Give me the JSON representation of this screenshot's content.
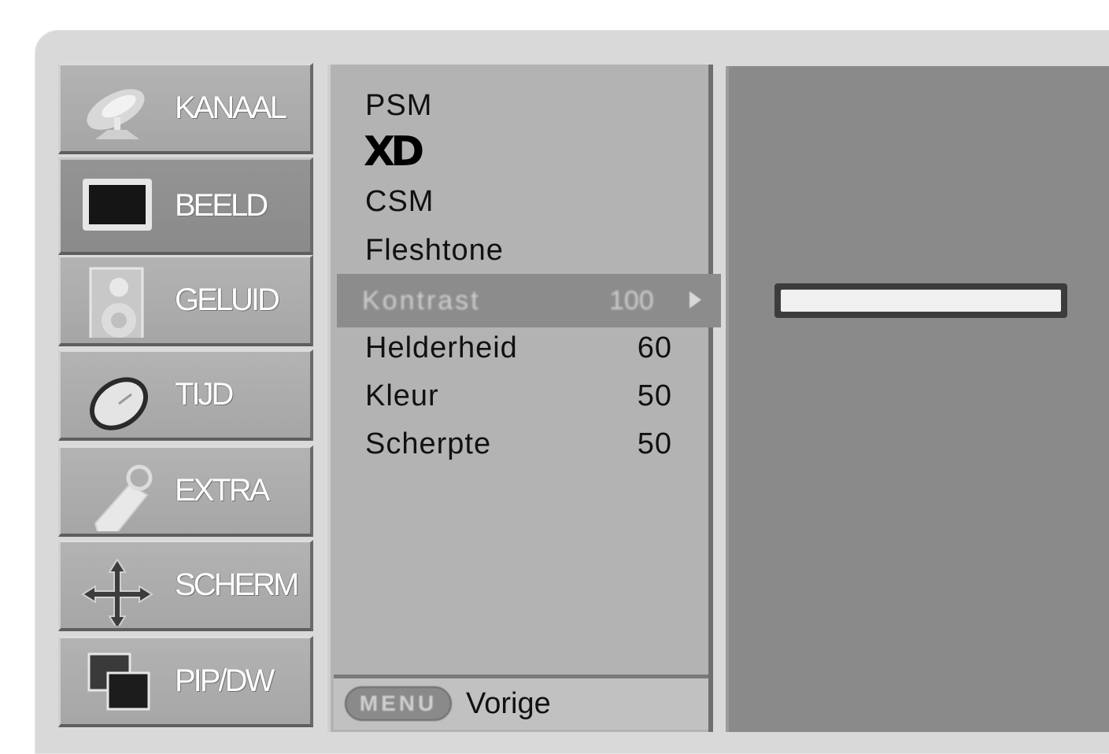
{
  "categories": [
    {
      "label": "KANAAL",
      "icon": "satellite-dish-icon"
    },
    {
      "label": "BEELD",
      "icon": "tv-screen-icon"
    },
    {
      "label": "GELUID",
      "icon": "speaker-icon"
    },
    {
      "label": "TIJD",
      "icon": "clock-icon"
    },
    {
      "label": "EXTRA",
      "icon": "tag-icon"
    },
    {
      "label": "SCHERM",
      "icon": "move-arrows-icon"
    },
    {
      "label": "PIP/DW",
      "icon": "pip-windows-icon"
    }
  ],
  "active_category": "BEELD",
  "submenu": {
    "psm": "PSM",
    "xd": "XD",
    "csm": "CSM",
    "fleshtone": "Fleshtone",
    "selected": {
      "label": "Kontrast",
      "value": "100"
    },
    "items": [
      {
        "label": "Helderheid",
        "value": "60"
      },
      {
        "label": "Kleur",
        "value": "50"
      },
      {
        "label": "Scherpte",
        "value": "50"
      }
    ]
  },
  "footer": {
    "key_label": "MENU",
    "back_label": "Vorige"
  },
  "slider": {
    "level_percent": 100
  }
}
